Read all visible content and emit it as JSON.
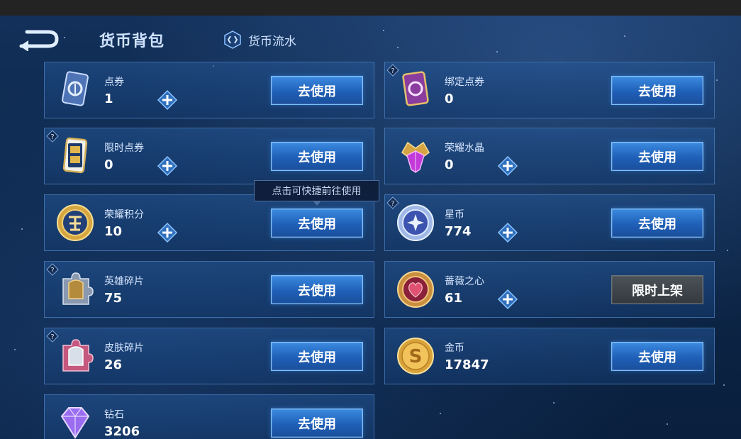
{
  "header": {
    "title": "货币背包",
    "flow_label": "货币流水"
  },
  "tooltip": "点击可快捷前往使用",
  "currencies": [
    {
      "name": "点券",
      "amount": "1",
      "action": "去使用",
      "icon": "coupon-icon",
      "has_plus": true,
      "has_help": false
    },
    {
      "name": "绑定点券",
      "amount": "0",
      "action": "去使用",
      "icon": "bound-coupon-icon",
      "has_plus": false,
      "has_help": true
    },
    {
      "name": "限时点券",
      "amount": "0",
      "action": "去使用",
      "icon": "limited-coupon-icon",
      "has_plus": true,
      "has_help": true
    },
    {
      "name": "荣耀水晶",
      "amount": "0",
      "action": "去使用",
      "icon": "glory-crystal-icon",
      "has_plus": true,
      "has_help": false
    },
    {
      "name": "荣耀积分",
      "amount": "10",
      "action": "去使用",
      "icon": "glory-points-icon",
      "has_plus": true,
      "has_help": false
    },
    {
      "name": "星币",
      "amount": "774",
      "action": "去使用",
      "icon": "star-coin-icon",
      "has_plus": true,
      "has_help": true
    },
    {
      "name": "英雄碎片",
      "amount": "75",
      "action": "去使用",
      "icon": "hero-fragment-icon",
      "has_plus": false,
      "has_help": true
    },
    {
      "name": "蔷薇之心",
      "amount": "61",
      "action": "限时上架",
      "icon": "rose-heart-icon",
      "has_plus": true,
      "has_help": false
    },
    {
      "name": "皮肤碎片",
      "amount": "26",
      "action": "去使用",
      "icon": "skin-fragment-icon",
      "has_plus": false,
      "has_help": true
    },
    {
      "name": "金币",
      "amount": "17847",
      "action": "去使用",
      "icon": "gold-coin-icon",
      "has_plus": false,
      "has_help": false
    },
    {
      "name": "钻石",
      "amount": "3206",
      "action": "去使用",
      "icon": "diamond-icon",
      "has_plus": false,
      "has_help": false
    }
  ],
  "colors": {
    "button_blue": "#2a6fc9",
    "button_gray": "#3f464b",
    "card_border": "#5f96d7",
    "background": "#0d2749"
  }
}
